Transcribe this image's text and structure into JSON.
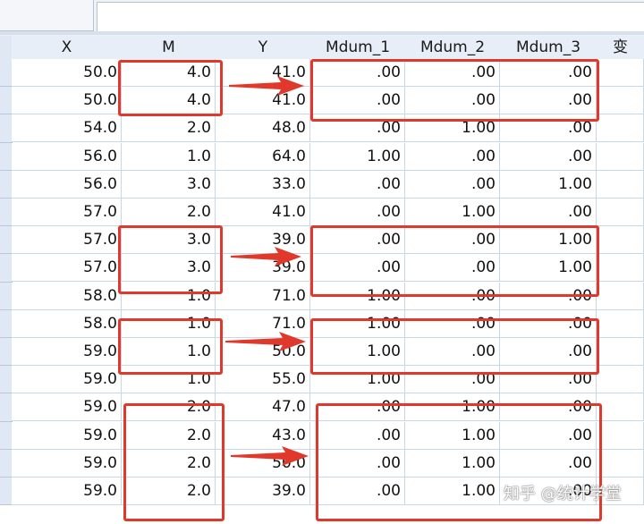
{
  "columns": [
    "X",
    "M",
    "Y",
    "Mdum_1",
    "Mdum_2",
    "Mdum_3",
    "变"
  ],
  "rows": [
    [
      "50.0",
      "4.0",
      "41.0",
      ".00",
      ".00",
      ".00"
    ],
    [
      "50.0",
      "4.0",
      "41.0",
      ".00",
      ".00",
      ".00"
    ],
    [
      "54.0",
      "2.0",
      "48.0",
      ".00",
      "1.00",
      ".00"
    ],
    [
      "56.0",
      "1.0",
      "64.0",
      "1.00",
      ".00",
      ".00"
    ],
    [
      "56.0",
      "3.0",
      "33.0",
      ".00",
      ".00",
      "1.00"
    ],
    [
      "57.0",
      "2.0",
      "41.0",
      ".00",
      "1.00",
      ".00"
    ],
    [
      "57.0",
      "3.0",
      "39.0",
      ".00",
      ".00",
      "1.00"
    ],
    [
      "57.0",
      "3.0",
      "39.0",
      ".00",
      ".00",
      "1.00"
    ],
    [
      "58.0",
      "1.0",
      "71.0",
      "1.00",
      ".00",
      ".00"
    ],
    [
      "58.0",
      "1.0",
      "71.0",
      "1.00",
      ".00",
      ".00"
    ],
    [
      "59.0",
      "1.0",
      "50.0",
      "1.00",
      ".00",
      ".00"
    ],
    [
      "59.0",
      "1.0",
      "55.0",
      "1.00",
      ".00",
      ".00"
    ],
    [
      "59.0",
      "2.0",
      "47.0",
      ".00",
      "1.00",
      ".00"
    ],
    [
      "59.0",
      "2.0",
      "43.0",
      ".00",
      "1.00",
      ".00"
    ],
    [
      "59.0",
      "2.0",
      "50.0",
      ".00",
      "1.00",
      ".00"
    ],
    [
      "59.0",
      "2.0",
      "39.0",
      ".00",
      "1.00",
      ".00"
    ]
  ],
  "watermark": "知乎 @统计学堂",
  "annotation_color": "#e0382b"
}
